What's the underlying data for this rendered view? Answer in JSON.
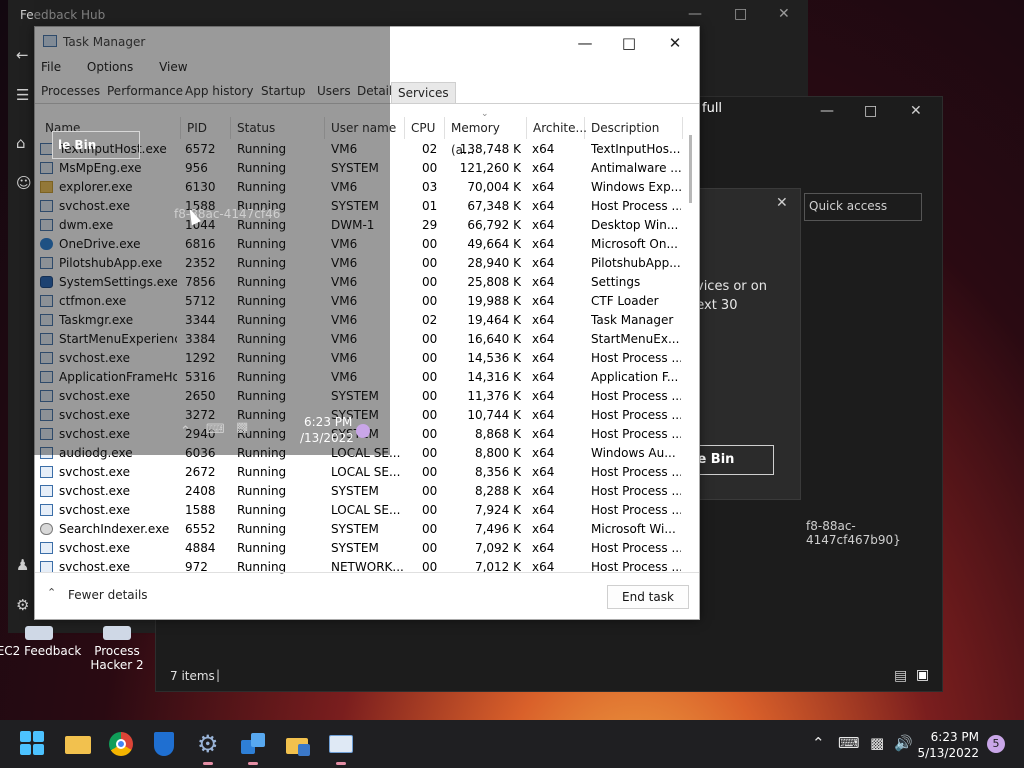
{
  "feedback_window": {
    "title": "Feedback Hub"
  },
  "explorer_window": {
    "items_count": "7 items"
  },
  "dialog": {
    "search_placeholder": "Quick access",
    "heading_partial": "full",
    "body_line1": "evices or on",
    "body_line2": "next 30",
    "button_label": "le Bin",
    "guid_text": "f8-88ac-4147cf467b90}"
  },
  "ghost": {
    "recycle_bin_label": "le Bin",
    "guid_text": "f8-88ac-4147cf46",
    "clock_time": "6:23 PM",
    "clock_date": "/13/2022"
  },
  "task_manager": {
    "title": "Task Manager",
    "menu": [
      "File",
      "Options",
      "View"
    ],
    "tabs": [
      "Processes",
      "Performance",
      "App history",
      "Startup",
      "Users",
      "Details",
      "Services"
    ],
    "active_tab": "Services",
    "columns": [
      "Name",
      "PID",
      "Status",
      "User name",
      "CPU",
      "Memory (a...",
      "Archite...",
      "Description"
    ],
    "rows": [
      {
        "name": "TextInputHost.exe",
        "pid": "6572",
        "status": "Running",
        "user": "VM6",
        "cpu": "02",
        "mem": "138,748 K",
        "arch": "x64",
        "desc": "TextInputHos..."
      },
      {
        "name": "MsMpEng.exe",
        "pid": "956",
        "status": "Running",
        "user": "SYSTEM",
        "cpu": "00",
        "mem": "121,260 K",
        "arch": "x64",
        "desc": "Antimalware ..."
      },
      {
        "name": "explorer.exe",
        "pid": "6130",
        "status": "Running",
        "user": "VM6",
        "cpu": "03",
        "mem": "70,004 K",
        "arch": "x64",
        "desc": "Windows Exp..."
      },
      {
        "name": "svchost.exe",
        "pid": "1588",
        "status": "Running",
        "user": "SYSTEM",
        "cpu": "01",
        "mem": "67,348 K",
        "arch": "x64",
        "desc": "Host Process ..."
      },
      {
        "name": "dwm.exe",
        "pid": "1044",
        "status": "Running",
        "user": "DWM-1",
        "cpu": "29",
        "mem": "66,792 K",
        "arch": "x64",
        "desc": "Desktop Win..."
      },
      {
        "name": "OneDrive.exe",
        "pid": "6816",
        "status": "Running",
        "user": "VM6",
        "cpu": "00",
        "mem": "49,664 K",
        "arch": "x64",
        "desc": "Microsoft On..."
      },
      {
        "name": "PilotshubApp.exe",
        "pid": "2352",
        "status": "Running",
        "user": "VM6",
        "cpu": "00",
        "mem": "28,940 K",
        "arch": "x64",
        "desc": "PilotshubApp..."
      },
      {
        "name": "SystemSettings.exe",
        "pid": "7856",
        "status": "Running",
        "user": "VM6",
        "cpu": "00",
        "mem": "25,808 K",
        "arch": "x64",
        "desc": "Settings"
      },
      {
        "name": "ctfmon.exe",
        "pid": "5712",
        "status": "Running",
        "user": "VM6",
        "cpu": "00",
        "mem": "19,988 K",
        "arch": "x64",
        "desc": "CTF Loader"
      },
      {
        "name": "Taskmgr.exe",
        "pid": "3344",
        "status": "Running",
        "user": "VM6",
        "cpu": "02",
        "mem": "19,464 K",
        "arch": "x64",
        "desc": "Task Manager"
      },
      {
        "name": "StartMenuExperience...",
        "pid": "3384",
        "status": "Running",
        "user": "VM6",
        "cpu": "00",
        "mem": "16,640 K",
        "arch": "x64",
        "desc": "StartMenuEx..."
      },
      {
        "name": "svchost.exe",
        "pid": "1292",
        "status": "Running",
        "user": "VM6",
        "cpu": "00",
        "mem": "14,536 K",
        "arch": "x64",
        "desc": "Host Process ..."
      },
      {
        "name": "ApplicationFrameHo...",
        "pid": "5316",
        "status": "Running",
        "user": "VM6",
        "cpu": "00",
        "mem": "14,316 K",
        "arch": "x64",
        "desc": "Application F..."
      },
      {
        "name": "svchost.exe",
        "pid": "2650",
        "status": "Running",
        "user": "SYSTEM",
        "cpu": "00",
        "mem": "11,376 K",
        "arch": "x64",
        "desc": "Host Process ..."
      },
      {
        "name": "svchost.exe",
        "pid": "3272",
        "status": "Running",
        "user": "SYSTEM",
        "cpu": "00",
        "mem": "10,744 K",
        "arch": "x64",
        "desc": "Host Process ..."
      },
      {
        "name": "svchost.exe",
        "pid": "2940",
        "status": "Running",
        "user": "SYSTEM",
        "cpu": "00",
        "mem": "8,868 K",
        "arch": "x64",
        "desc": "Host Process ..."
      },
      {
        "name": "audiodg.exe",
        "pid": "6036",
        "status": "Running",
        "user": "LOCAL SE...",
        "cpu": "00",
        "mem": "8,800 K",
        "arch": "x64",
        "desc": "Windows Au..."
      },
      {
        "name": "svchost.exe",
        "pid": "2672",
        "status": "Running",
        "user": "LOCAL SE...",
        "cpu": "00",
        "mem": "8,356 K",
        "arch": "x64",
        "desc": "Host Process ..."
      },
      {
        "name": "svchost.exe",
        "pid": "2408",
        "status": "Running",
        "user": "SYSTEM",
        "cpu": "00",
        "mem": "8,288 K",
        "arch": "x64",
        "desc": "Host Process ..."
      },
      {
        "name": "svchost.exe",
        "pid": "1588",
        "status": "Running",
        "user": "LOCAL SE...",
        "cpu": "00",
        "mem": "7,924 K",
        "arch": "x64",
        "desc": "Host Process ..."
      },
      {
        "name": "SearchIndexer.exe",
        "pid": "6552",
        "status": "Running",
        "user": "SYSTEM",
        "cpu": "00",
        "mem": "7,496 K",
        "arch": "x64",
        "desc": "Microsoft Wi..."
      },
      {
        "name": "svchost.exe",
        "pid": "4884",
        "status": "Running",
        "user": "SYSTEM",
        "cpu": "00",
        "mem": "7,092 K",
        "arch": "x64",
        "desc": "Host Process ..."
      },
      {
        "name": "svchost.exe",
        "pid": "972",
        "status": "Running",
        "user": "NETWORK...",
        "cpu": "00",
        "mem": "7,012 K",
        "arch": "x64",
        "desc": "Host Process ..."
      }
    ],
    "fewer_details": "Fewer details",
    "end_task": "End task"
  },
  "desktop_icons": [
    {
      "label": "EC2 Feedback"
    },
    {
      "label": "Process Hacker 2"
    }
  ],
  "taskbar": {
    "apps": [
      "start-icon",
      "file-explorer-icon",
      "chrome-icon",
      "defender-icon",
      "settings-icon",
      "remote-desktop-icon",
      "folder-notes-icon",
      "task-manager-icon"
    ],
    "clock_time": "6:23 PM",
    "clock_date": "5/13/2022",
    "notification_count": "5"
  }
}
